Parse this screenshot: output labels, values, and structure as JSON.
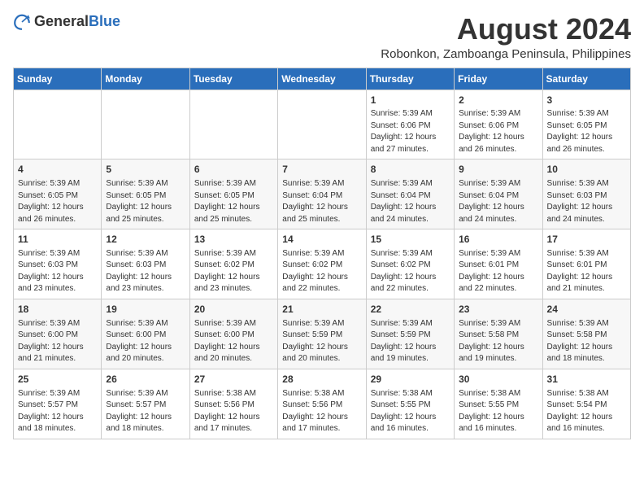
{
  "header": {
    "logo_general": "General",
    "logo_blue": "Blue",
    "title": "August 2024",
    "subtitle": "Robonkon, Zamboanga Peninsula, Philippines"
  },
  "calendar": {
    "days_of_week": [
      "Sunday",
      "Monday",
      "Tuesday",
      "Wednesday",
      "Thursday",
      "Friday",
      "Saturday"
    ],
    "weeks": [
      [
        {
          "day": "",
          "info": ""
        },
        {
          "day": "",
          "info": ""
        },
        {
          "day": "",
          "info": ""
        },
        {
          "day": "",
          "info": ""
        },
        {
          "day": "1",
          "info": "Sunrise: 5:39 AM\nSunset: 6:06 PM\nDaylight: 12 hours\nand 27 minutes."
        },
        {
          "day": "2",
          "info": "Sunrise: 5:39 AM\nSunset: 6:06 PM\nDaylight: 12 hours\nand 26 minutes."
        },
        {
          "day": "3",
          "info": "Sunrise: 5:39 AM\nSunset: 6:05 PM\nDaylight: 12 hours\nand 26 minutes."
        }
      ],
      [
        {
          "day": "4",
          "info": "Sunrise: 5:39 AM\nSunset: 6:05 PM\nDaylight: 12 hours\nand 26 minutes."
        },
        {
          "day": "5",
          "info": "Sunrise: 5:39 AM\nSunset: 6:05 PM\nDaylight: 12 hours\nand 25 minutes."
        },
        {
          "day": "6",
          "info": "Sunrise: 5:39 AM\nSunset: 6:05 PM\nDaylight: 12 hours\nand 25 minutes."
        },
        {
          "day": "7",
          "info": "Sunrise: 5:39 AM\nSunset: 6:04 PM\nDaylight: 12 hours\nand 25 minutes."
        },
        {
          "day": "8",
          "info": "Sunrise: 5:39 AM\nSunset: 6:04 PM\nDaylight: 12 hours\nand 24 minutes."
        },
        {
          "day": "9",
          "info": "Sunrise: 5:39 AM\nSunset: 6:04 PM\nDaylight: 12 hours\nand 24 minutes."
        },
        {
          "day": "10",
          "info": "Sunrise: 5:39 AM\nSunset: 6:03 PM\nDaylight: 12 hours\nand 24 minutes."
        }
      ],
      [
        {
          "day": "11",
          "info": "Sunrise: 5:39 AM\nSunset: 6:03 PM\nDaylight: 12 hours\nand 23 minutes."
        },
        {
          "day": "12",
          "info": "Sunrise: 5:39 AM\nSunset: 6:03 PM\nDaylight: 12 hours\nand 23 minutes."
        },
        {
          "day": "13",
          "info": "Sunrise: 5:39 AM\nSunset: 6:02 PM\nDaylight: 12 hours\nand 23 minutes."
        },
        {
          "day": "14",
          "info": "Sunrise: 5:39 AM\nSunset: 6:02 PM\nDaylight: 12 hours\nand 22 minutes."
        },
        {
          "day": "15",
          "info": "Sunrise: 5:39 AM\nSunset: 6:02 PM\nDaylight: 12 hours\nand 22 minutes."
        },
        {
          "day": "16",
          "info": "Sunrise: 5:39 AM\nSunset: 6:01 PM\nDaylight: 12 hours\nand 22 minutes."
        },
        {
          "day": "17",
          "info": "Sunrise: 5:39 AM\nSunset: 6:01 PM\nDaylight: 12 hours\nand 21 minutes."
        }
      ],
      [
        {
          "day": "18",
          "info": "Sunrise: 5:39 AM\nSunset: 6:00 PM\nDaylight: 12 hours\nand 21 minutes."
        },
        {
          "day": "19",
          "info": "Sunrise: 5:39 AM\nSunset: 6:00 PM\nDaylight: 12 hours\nand 20 minutes."
        },
        {
          "day": "20",
          "info": "Sunrise: 5:39 AM\nSunset: 6:00 PM\nDaylight: 12 hours\nand 20 minutes."
        },
        {
          "day": "21",
          "info": "Sunrise: 5:39 AM\nSunset: 5:59 PM\nDaylight: 12 hours\nand 20 minutes."
        },
        {
          "day": "22",
          "info": "Sunrise: 5:39 AM\nSunset: 5:59 PM\nDaylight: 12 hours\nand 19 minutes."
        },
        {
          "day": "23",
          "info": "Sunrise: 5:39 AM\nSunset: 5:58 PM\nDaylight: 12 hours\nand 19 minutes."
        },
        {
          "day": "24",
          "info": "Sunrise: 5:39 AM\nSunset: 5:58 PM\nDaylight: 12 hours\nand 18 minutes."
        }
      ],
      [
        {
          "day": "25",
          "info": "Sunrise: 5:39 AM\nSunset: 5:57 PM\nDaylight: 12 hours\nand 18 minutes."
        },
        {
          "day": "26",
          "info": "Sunrise: 5:39 AM\nSunset: 5:57 PM\nDaylight: 12 hours\nand 18 minutes."
        },
        {
          "day": "27",
          "info": "Sunrise: 5:38 AM\nSunset: 5:56 PM\nDaylight: 12 hours\nand 17 minutes."
        },
        {
          "day": "28",
          "info": "Sunrise: 5:38 AM\nSunset: 5:56 PM\nDaylight: 12 hours\nand 17 minutes."
        },
        {
          "day": "29",
          "info": "Sunrise: 5:38 AM\nSunset: 5:55 PM\nDaylight: 12 hours\nand 16 minutes."
        },
        {
          "day": "30",
          "info": "Sunrise: 5:38 AM\nSunset: 5:55 PM\nDaylight: 12 hours\nand 16 minutes."
        },
        {
          "day": "31",
          "info": "Sunrise: 5:38 AM\nSunset: 5:54 PM\nDaylight: 12 hours\nand 16 minutes."
        }
      ]
    ]
  }
}
